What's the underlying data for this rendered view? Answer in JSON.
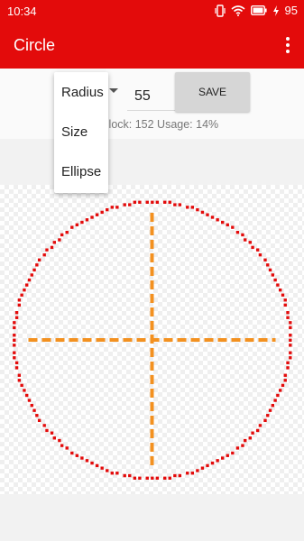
{
  "status_bar": {
    "time": "10:34",
    "battery": "95"
  },
  "app_bar": {
    "title": "Circle",
    "overflow_icon": "more-vert-icon"
  },
  "controls": {
    "mode_selected": "Radius",
    "value": "55",
    "save_label": "SAVE",
    "stats_visible": "27 Block: 152 Usage: 14%"
  },
  "dropdown": {
    "options": [
      "Radius",
      "Size",
      "Ellipse"
    ]
  },
  "canvas": {
    "shape": "circle",
    "radius": 55,
    "block_count": 152,
    "circle_color": "#e30b0b",
    "axis_color": "#f39120"
  },
  "colors": {
    "primary": "#e30b0b",
    "accent": "#f39120"
  }
}
